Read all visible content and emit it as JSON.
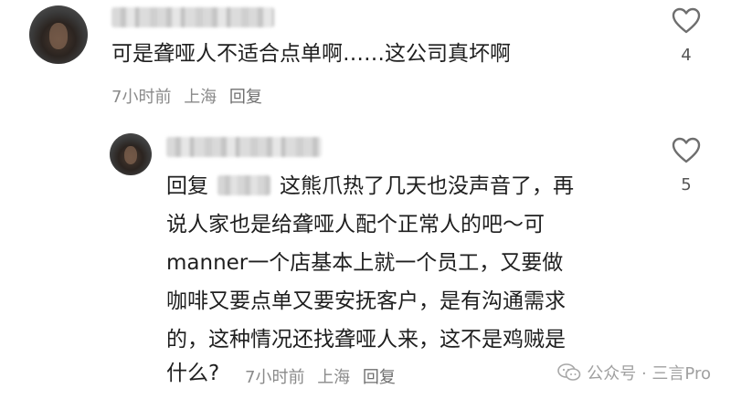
{
  "comment": {
    "text": "可是聋哑人不适合点单啊……这公司真坏啊",
    "time": "7小时前",
    "location": "上海",
    "reply_label": "回复",
    "likes": "4"
  },
  "reply": {
    "prefix": "回复",
    "lines": [
      "这熊爪热了几天也没声音了，再",
      "说人家也是给聋哑人配个正常人的吧～可",
      "manner一个店基本上就一个员工，又要做",
      "咖啡又要点单又要安抚客户，是有沟通需求",
      "的，这种情况还找聋哑人来，这不是鸡贼是",
      "什么?"
    ],
    "time": "7小时前",
    "location": "上海",
    "reply_label": "回复",
    "likes": "5"
  },
  "watermark": {
    "text": "公众号 · 三言Pro",
    "icon": "wechat-icon"
  },
  "icons": {
    "like": "heart-outline-icon"
  },
  "colors": {
    "meta": "#8a8a8a",
    "text": "#1f1f1f",
    "watermark": "#a0a0a0"
  }
}
